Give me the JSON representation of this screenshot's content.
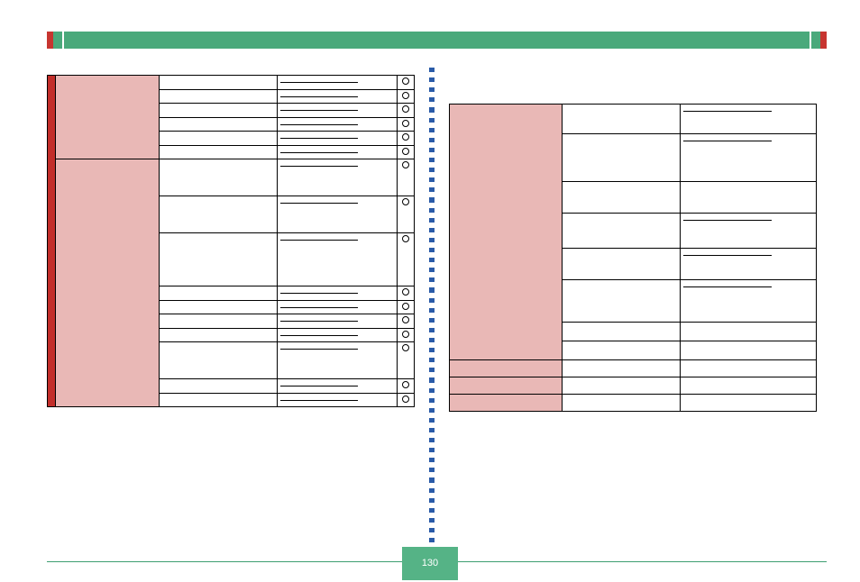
{
  "page_number": "130",
  "divider_dots": 48,
  "left_table": {
    "group1": {
      "span_rows": 6,
      "category": "",
      "rows": [
        {
          "aq": "",
          "crit": "",
          "score": ""
        },
        {
          "aq": "",
          "crit": "",
          "score": ""
        },
        {
          "aq": "",
          "crit": "",
          "score": ""
        },
        {
          "aq": "",
          "crit": "",
          "score": ""
        },
        {
          "aq": "",
          "crit": "",
          "score": ""
        },
        {
          "aq": "",
          "crit": "",
          "score": ""
        }
      ]
    },
    "group2": {
      "span_rows": 10,
      "category": "",
      "rows": [
        {
          "aq": "",
          "crit": "",
          "score": "",
          "tall": true
        },
        {
          "aq": "",
          "crit": "",
          "score": "",
          "tall": true
        },
        {
          "aq": "",
          "crit": "",
          "score": "",
          "tall": true
        },
        {
          "aq": "",
          "crit": "",
          "score": ""
        },
        {
          "aq": "",
          "crit": "",
          "score": ""
        },
        {
          "aq": "",
          "crit": "",
          "score": ""
        },
        {
          "aq": "",
          "crit": "",
          "score": ""
        },
        {
          "aq": "",
          "crit": "",
          "score": "",
          "tall": true
        },
        {
          "aq": "",
          "crit": "",
          "score": ""
        },
        {
          "aq": "",
          "crit": "",
          "score": ""
        }
      ]
    }
  },
  "right_table": {
    "group": {
      "span_rows": 8,
      "category": "",
      "rows": [
        {
          "aq": "",
          "crit": "",
          "h": "28"
        },
        {
          "aq": "",
          "crit": "",
          "h": "48"
        },
        {
          "aq": "",
          "crit": "",
          "h": "30"
        },
        {
          "aq": "",
          "crit": "",
          "h": "34"
        },
        {
          "aq": "",
          "crit": "",
          "h": "30"
        },
        {
          "aq": "",
          "crit": "",
          "h": "42"
        },
        {
          "aq": "",
          "crit": "",
          "h": "16"
        },
        {
          "aq": "",
          "crit": "",
          "h": "16"
        }
      ]
    },
    "tail_rows": [
      {
        "cat": "",
        "aq": "",
        "crit": ""
      },
      {
        "cat": "",
        "aq": "",
        "crit": ""
      },
      {
        "cat": "",
        "aq": "",
        "crit": ""
      }
    ]
  }
}
